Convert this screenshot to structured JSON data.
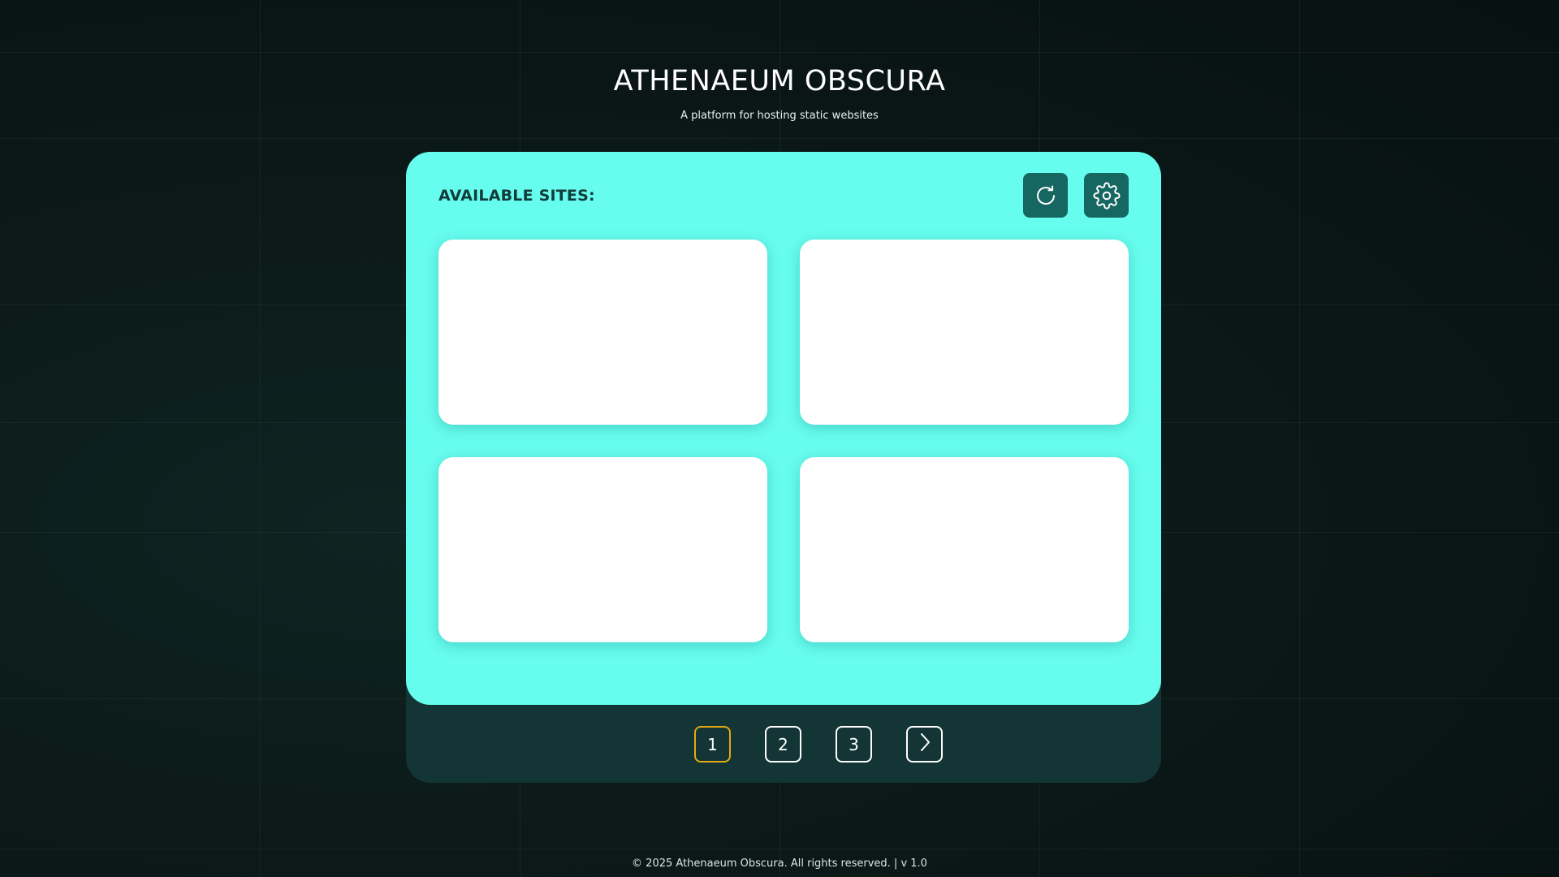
{
  "header": {
    "title": "ATHENAEUM OBSCURA",
    "subtitle": "A platform for hosting static websites"
  },
  "panel": {
    "label": "AVAILABLE SITES:",
    "tools": [
      {
        "icon": "refresh-icon"
      },
      {
        "icon": "gear-icon"
      }
    ],
    "cards": [
      {
        "label": ""
      },
      {
        "label": ""
      },
      {
        "label": ""
      },
      {
        "label": ""
      }
    ]
  },
  "pagination": {
    "pages": [
      "1",
      "2",
      "3"
    ],
    "current_page": "1",
    "next_icon": "chevron-right-icon"
  },
  "footer": {
    "text": "© 2025 Athenaeum Obscura. All rights reserved. | v 1.0"
  },
  "colors": {
    "background": "#0b1918",
    "panel": "#66fcee",
    "panel_base": "#133535",
    "button": "#166662",
    "active_page": "#e5a813",
    "card": "#ffffff"
  }
}
